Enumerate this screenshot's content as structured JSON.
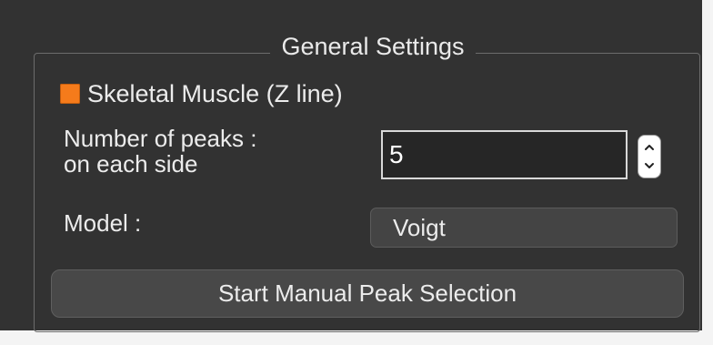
{
  "general_settings": {
    "title": "General Settings",
    "skeletal_muscle": {
      "label": "Skeletal Muscle (Z line)",
      "checked": true,
      "check_color": "#f57b1b"
    },
    "number_of_peaks": {
      "label_line1": "Number of peaks :",
      "label_line2": "on each side",
      "value": "5"
    },
    "model": {
      "label": "Model :",
      "selected": "Voigt"
    },
    "start_button": {
      "label": "Start Manual Peak Selection"
    }
  },
  "icons": {
    "spin_up": "chevron-up-icon",
    "spin_down": "chevron-down-icon"
  }
}
